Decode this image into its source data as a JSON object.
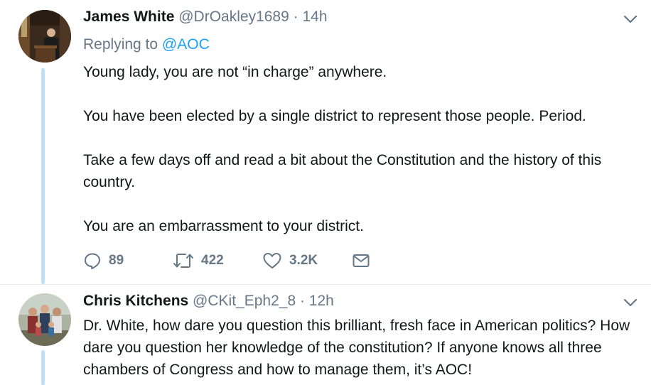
{
  "tweets": [
    {
      "author": {
        "name": "James White",
        "handle": "@DrOakley1689",
        "avatar": "speaker-at-podium-avatar"
      },
      "separator": "·",
      "time": "14h",
      "replying_prefix": "Replying to",
      "replying_to": "@AOC",
      "body": [
        "Young lady, you are not “in charge” anywhere.",
        "You have been elected by a single district to represent those people.  Period.",
        "Take a few days off and read a bit about the Constitution and the history of this country.",
        "You are an embarrassment to your district."
      ],
      "actions": {
        "reply": {
          "icon": "reply-icon",
          "count": "89"
        },
        "retweet": {
          "icon": "retweet-icon",
          "count": "422"
        },
        "like": {
          "icon": "heart-icon",
          "count": "3.2K"
        },
        "message": {
          "icon": "envelope-icon"
        }
      },
      "menu_icon": "chevron-down-icon"
    },
    {
      "author": {
        "name": "Chris Kitchens",
        "handle": "@CKit_Eph2_8",
        "avatar": "family-group-avatar"
      },
      "separator": "·",
      "time": "12h",
      "body": [
        "Dr. White, how dare you question this brilliant, fresh face in American politics?  How dare you question her knowledge of the constitution?  If anyone knows all three chambers of Congress and how to manage them, it’s AOC!"
      ],
      "menu_icon": "chevron-down-icon"
    }
  ],
  "colors": {
    "text": "#14171a",
    "muted": "#657786",
    "link": "#1da1f2",
    "thread_line": "#c2e0f4",
    "divider": "#e6ecf0"
  }
}
